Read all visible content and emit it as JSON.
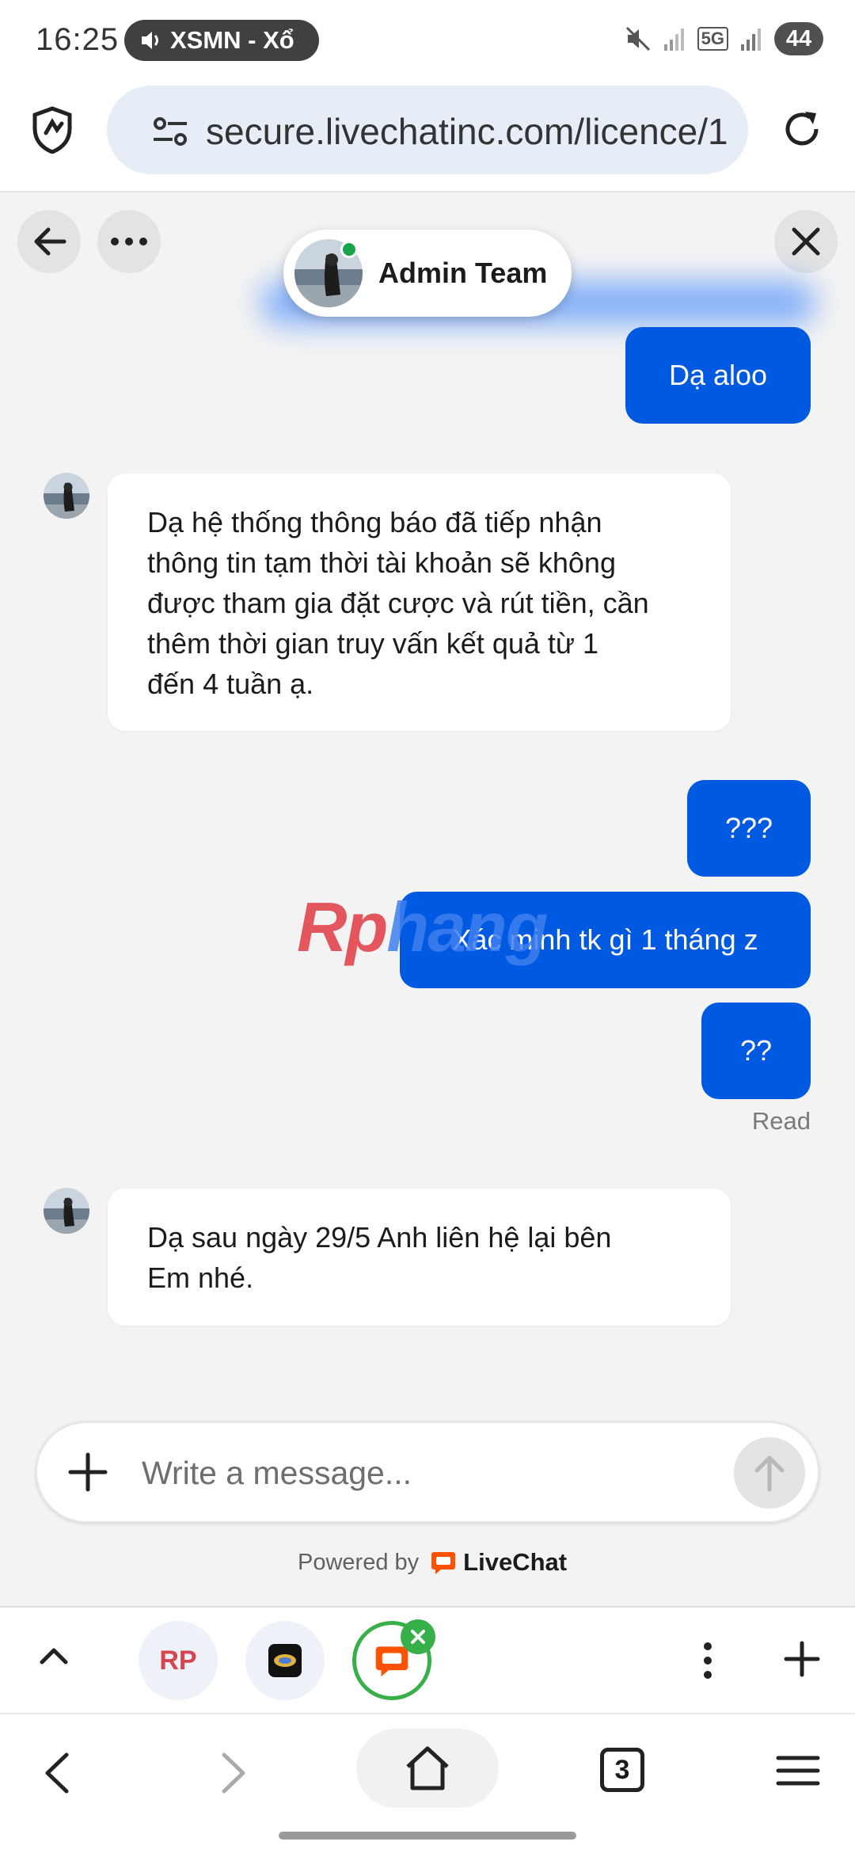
{
  "status_bar": {
    "time": "16:25",
    "media_label": "XSMN - Xổ",
    "network": "5G",
    "battery": "44"
  },
  "browser": {
    "url": "secure.livechatinc.com/licence/1",
    "tab_count": "3",
    "icons": [
      "shield-icon",
      "site-settings-icon",
      "reload-icon"
    ]
  },
  "chat": {
    "agent_name": "Admin Team",
    "agent_online": true,
    "messages": [
      {
        "from": "visitor",
        "text": "Dạ aloo"
      },
      {
        "from": "agent",
        "lines": [
          "Dạ hệ thống thông báo đã tiếp nhận",
          "thông tin tạm thời tài khoản sẽ không",
          "được tham gia đặt cược và rút tiền, cần",
          "thêm thời gian truy vấn kết quả từ 1",
          "đến 4 tuần ạ."
        ]
      },
      {
        "from": "visitor",
        "text": "???"
      },
      {
        "from": "visitor",
        "text": "Xác minh tk gì 1 tháng z"
      },
      {
        "from": "visitor",
        "text": "??"
      },
      {
        "from": "agent",
        "lines": [
          "Dạ sau ngày 29/5 Anh liên hệ lại bên",
          "Em nhé."
        ]
      }
    ],
    "read_receipt": "Read",
    "composer_placeholder": "Write a message...",
    "powered_by": "Powered by",
    "brand": "LiveChat",
    "watermark": {
      "part1": "Rp",
      "part2": "hang"
    }
  },
  "tab_strip": {
    "tabs": [
      {
        "label": "RP"
      },
      {
        "label": ""
      },
      {
        "label": "",
        "active": true
      }
    ]
  },
  "colors": {
    "visitor_bubble": "#0059e1",
    "agent_bubble": "#ffffff",
    "chat_background": "#f3f3f3",
    "online": "#16a34a",
    "livechat_orange": "#ff5100",
    "active_tab_ring": "#37b04a"
  }
}
